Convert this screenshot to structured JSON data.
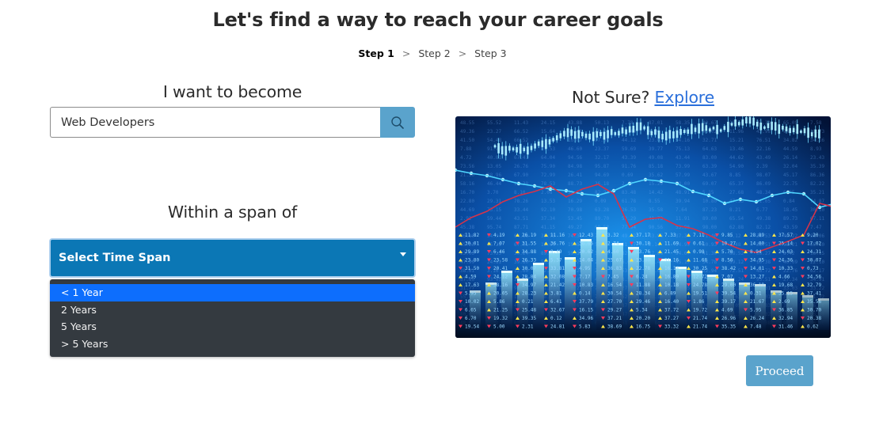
{
  "page": {
    "title": "Let's find a way to reach your career goals"
  },
  "steps": {
    "items": [
      "Step 1",
      "Step 2",
      "Step 3"
    ],
    "separator": ">"
  },
  "career": {
    "heading": "I want to become",
    "search_value": "Web Developers",
    "search_icon": "search-icon"
  },
  "timespan": {
    "heading": "Within a span of",
    "select_label": "Select Time Span",
    "options": [
      "< 1 Year",
      "2 Years",
      "5 Years",
      "> 5 Years"
    ],
    "highlighted_index": 0
  },
  "explore": {
    "prefix": "Not Sure?",
    "link": "Explore"
  },
  "actions": {
    "proceed_label": "Proceed"
  },
  "colors": {
    "accent": "#0b77b5",
    "button": "#5aa3cc",
    "dropdown_bg": "#343a40",
    "highlight": "#0d6efd",
    "link": "#2a6fdb"
  }
}
